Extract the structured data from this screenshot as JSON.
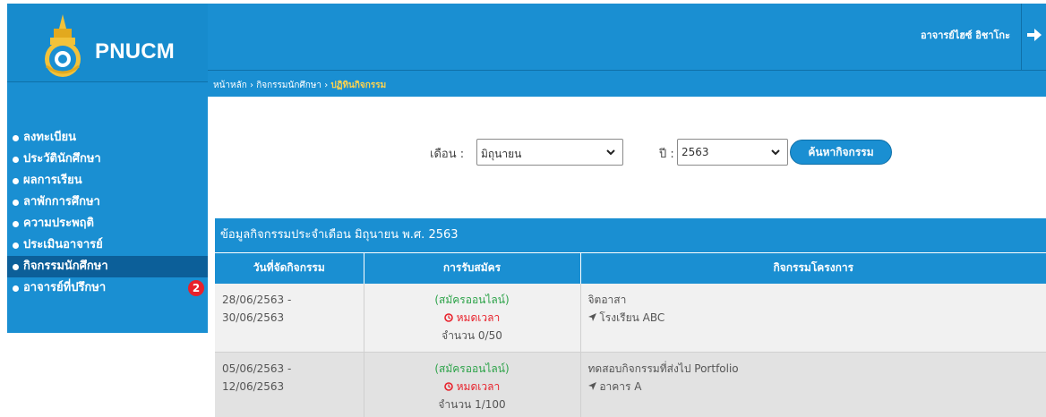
{
  "brand": {
    "name": "PNUCM"
  },
  "header": {
    "user_name": "อาจารย์ไฮซ์ อิชาโกะ",
    "breadcrumb": [
      "หน้าหลัก",
      "กิจกรรมนักศึกษา",
      "ปฏิทินกิจกรรม"
    ],
    "breadcrumb_sep": "›"
  },
  "sidebar": {
    "items": [
      {
        "label": "ลงทะเบียน",
        "active": false
      },
      {
        "label": "ประวัตินักศึกษา",
        "active": false
      },
      {
        "label": "ผลการเรียน",
        "active": false
      },
      {
        "label": "ลาพักการศึกษา",
        "active": false
      },
      {
        "label": "ความประพฤติ",
        "active": false
      },
      {
        "label": "ประเมินอาจารย์",
        "active": false
      },
      {
        "label": "กิจกรรมนักศึกษา",
        "active": true
      },
      {
        "label": "อาจารย์ที่ปรึกษา",
        "active": false,
        "badge": "2"
      }
    ]
  },
  "search": {
    "month_label": "เดือน :",
    "month_value": "มิถุนายน",
    "year_label": "ปี :",
    "year_value": "2563",
    "button_label": "ค้นหากิจกรรม"
  },
  "table": {
    "title": "ข้อมูลกิจกรรมประจำเดือน มิถุนายน พ.ศ. 2563",
    "columns": [
      "วันที่จัดกิจกรรม",
      "การรับสมัคร",
      "กิจกรรมโครงการ"
    ],
    "rows": [
      {
        "date": "28/06/2563 - 30/06/2563",
        "reg_type": "(สมัครออนไลน์)",
        "reg_status": "หมดเวลา",
        "reg_count": "จำนวน 0/50",
        "activity": "จิตอาสา",
        "location": "โรงเรียน ABC"
      },
      {
        "date": "05/06/2563 - 12/06/2563",
        "reg_type": "(สมัครออนไลน์)",
        "reg_status": "หมดเวลา",
        "reg_count": "จำนวน 1/100",
        "activity": "ทดสอบกิจกรรมที่ส่งไป Portfolio",
        "location": "อาคาร A"
      }
    ]
  },
  "colors": {
    "primary": "#1a8fd2",
    "active_menu": "#0c5f99",
    "badge": "#e8212b",
    "registration": "#2ea34a",
    "expired": "#e8212b"
  },
  "icons": [
    "logo-emblem",
    "logout-arrow-icon",
    "clock-icon",
    "location-arrow-icon",
    "chevron-down-icon"
  ]
}
